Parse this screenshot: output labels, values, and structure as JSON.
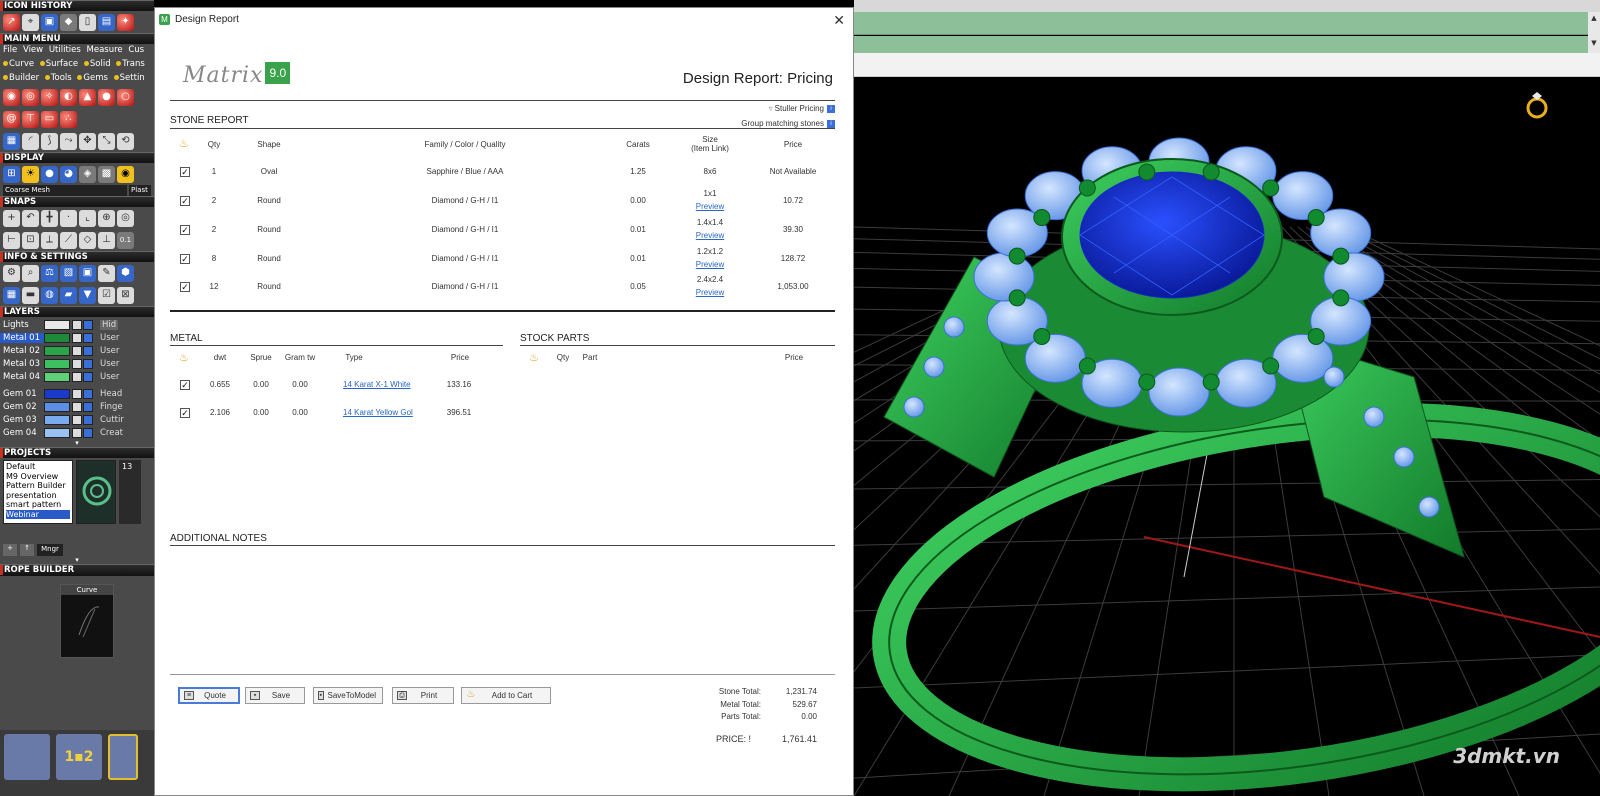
{
  "left_panel": {
    "icon_history": "ICON HISTORY",
    "main_menu": "MAIN MENU",
    "menu_items": [
      "File",
      "View",
      "Utilities",
      "Measure",
      "Cus"
    ],
    "menu_row2": [
      "Curve",
      "Surface",
      "Solid",
      "Trans"
    ],
    "menu_row3": [
      "Builder",
      "Tools",
      "Gems",
      "Settin"
    ],
    "display": "DISPLAY",
    "display_mode": "Coarse Mesh",
    "display_mode2": "Plast",
    "snaps": "SNAPS",
    "snap_value": "0.1",
    "info_settings": "INFO & SETTINGS",
    "layers": "LAYERS",
    "hide_label": "Hid",
    "layer_rows": [
      {
        "name": "Lights",
        "color": "#e8e8e8",
        "right": ""
      },
      {
        "name": "Metal 01",
        "color": "#1f8a3a",
        "right": "User"
      },
      {
        "name": "Metal 02",
        "color": "#2aa34a",
        "right": "User"
      },
      {
        "name": "Metal 03",
        "color": "#3cc060",
        "right": "User"
      },
      {
        "name": "Metal 04",
        "color": "#60d078",
        "right": "User"
      },
      {
        "name": "Gem 01",
        "color": "#1a3acc",
        "right": "Head"
      },
      {
        "name": "Gem 02",
        "color": "#5a90e8",
        "right": "Finge"
      },
      {
        "name": "Gem 03",
        "color": "#7aaaf0",
        "right": "Cuttir"
      },
      {
        "name": "Gem 04",
        "color": "#9ac0f4",
        "right": "Creat"
      }
    ],
    "projects": "PROJECTS",
    "project_list": [
      "Default",
      "M9 Overview",
      "Pattern Builder",
      "presentation",
      "smart pattern",
      "Webinar"
    ],
    "project_count": "13",
    "mngr": "Mngr",
    "rope_builder": "ROPE BUILDER",
    "curve_label": "Curve"
  },
  "dialog": {
    "window_title": "Design Report",
    "logo_text": "Matrix",
    "logo_version": "9.0",
    "title": "Design Report: Pricing",
    "option_stuller": "Stuller Pricing",
    "option_group": "Group matching stones",
    "stone_report_label": "STONE REPORT",
    "stone_headers": {
      "qty": "Qty",
      "shape": "Shape",
      "family": "Family / Color / Quality",
      "carats": "Carats",
      "size": "Size",
      "size_sub": "(Item Link)",
      "price": "Price"
    },
    "stones": [
      {
        "qty": "1",
        "shape": "Oval",
        "family": "Sapphire / Blue / AAA",
        "carats": "1.25",
        "size": "8x6",
        "preview": "",
        "price": "Not Available"
      },
      {
        "qty": "2",
        "shape": "Round",
        "family": "Diamond / G-H / I1",
        "carats": "0.00",
        "size": "1x1",
        "preview": "Preview",
        "price": "10.72"
      },
      {
        "qty": "2",
        "shape": "Round",
        "family": "Diamond / G-H / I1",
        "carats": "0.01",
        "size": "1.4x1.4",
        "preview": "Preview",
        "price": "39.30"
      },
      {
        "qty": "8",
        "shape": "Round",
        "family": "Diamond / G-H / I1",
        "carats": "0.01",
        "size": "1.2x1.2",
        "preview": "Preview",
        "price": "128.72"
      },
      {
        "qty": "12",
        "shape": "Round",
        "family": "Diamond / G-H / I1",
        "carats": "0.05",
        "size": "2.4x2.4",
        "preview": "Preview",
        "price": "1,053.00"
      }
    ],
    "metal_label": "METAL",
    "metal_headers": {
      "dwt": "dwt",
      "sprue": "Sprue",
      "gramtw": "Gram tw",
      "type": "Type",
      "price": "Price"
    },
    "metals": [
      {
        "dwt": "0.655",
        "sprue": "0.00",
        "gramtw": "0.00",
        "type": "14 Karat X-1 White",
        "price": "133.16"
      },
      {
        "dwt": "2.106",
        "sprue": "0.00",
        "gramtw": "0.00",
        "type": "14 Karat Yellow Gol",
        "price": "396.51"
      }
    ],
    "stock_parts_label": "STOCK PARTS",
    "stock_headers": {
      "qty": "Qty",
      "part": "Part",
      "price": "Price"
    },
    "notes_label": "ADDITIONAL NOTES",
    "buttons": {
      "quote": "Quote",
      "save": "Save",
      "savetomodel": "SaveToModel",
      "print": "Print",
      "cart": "Add to Cart"
    },
    "totals": {
      "stone_label": "Stone Total:",
      "stone_value": "1,231.74",
      "metal_label": "Metal Total:",
      "metal_value": "529.67",
      "parts_label": "Parts Total:",
      "parts_value": "0.00",
      "price_label": "PRICE: !",
      "price_value": "1,761.41"
    }
  },
  "viewport": {
    "watermark": "3dmkt.vn",
    "grid_color": "#4a4a4a",
    "metal_color": "#2ea84a",
    "gem_color": "#1a3acc",
    "diamond_color": "#8ab4f0"
  }
}
